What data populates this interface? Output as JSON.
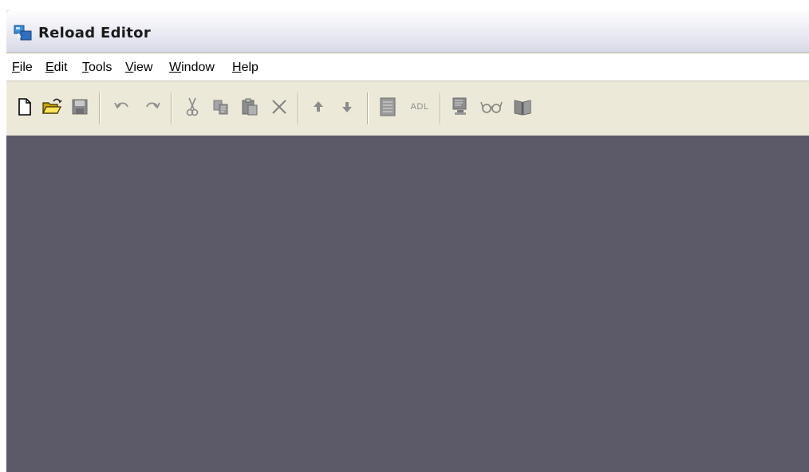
{
  "window": {
    "title": "Reload Editor",
    "app_icon": "reload-app-icon"
  },
  "menu": {
    "items": [
      {
        "label": "File"
      },
      {
        "label": "Edit"
      },
      {
        "label": "Tools"
      },
      {
        "label": "View"
      },
      {
        "label": "Window"
      },
      {
        "label": "Help"
      }
    ]
  },
  "toolbar": {
    "buttons": [
      {
        "icon": "new-file-icon",
        "enabled": true
      },
      {
        "icon": "open-folder-icon",
        "enabled": true
      },
      {
        "icon": "save-icon",
        "enabled": false
      },
      {
        "icon": "undo-icon",
        "enabled": false
      },
      {
        "icon": "redo-icon",
        "enabled": false
      },
      {
        "icon": "cut-icon",
        "enabled": false
      },
      {
        "icon": "copy-icon",
        "enabled": false
      },
      {
        "icon": "paste-icon",
        "enabled": false
      },
      {
        "icon": "delete-icon",
        "enabled": false
      },
      {
        "icon": "move-up-icon",
        "enabled": false
      },
      {
        "icon": "move-down-icon",
        "enabled": false
      },
      {
        "icon": "document-icon",
        "enabled": false
      },
      {
        "icon": "adl-icon",
        "enabled": false,
        "label": "ADL"
      },
      {
        "icon": "preview-package-icon",
        "enabled": false
      },
      {
        "icon": "view-glasses-icon",
        "enabled": false
      },
      {
        "icon": "book-icon",
        "enabled": false
      }
    ]
  },
  "colors": {
    "workspace": "#5c5a69",
    "chrome": "#ece9d8",
    "menubar": "#ffffff"
  }
}
